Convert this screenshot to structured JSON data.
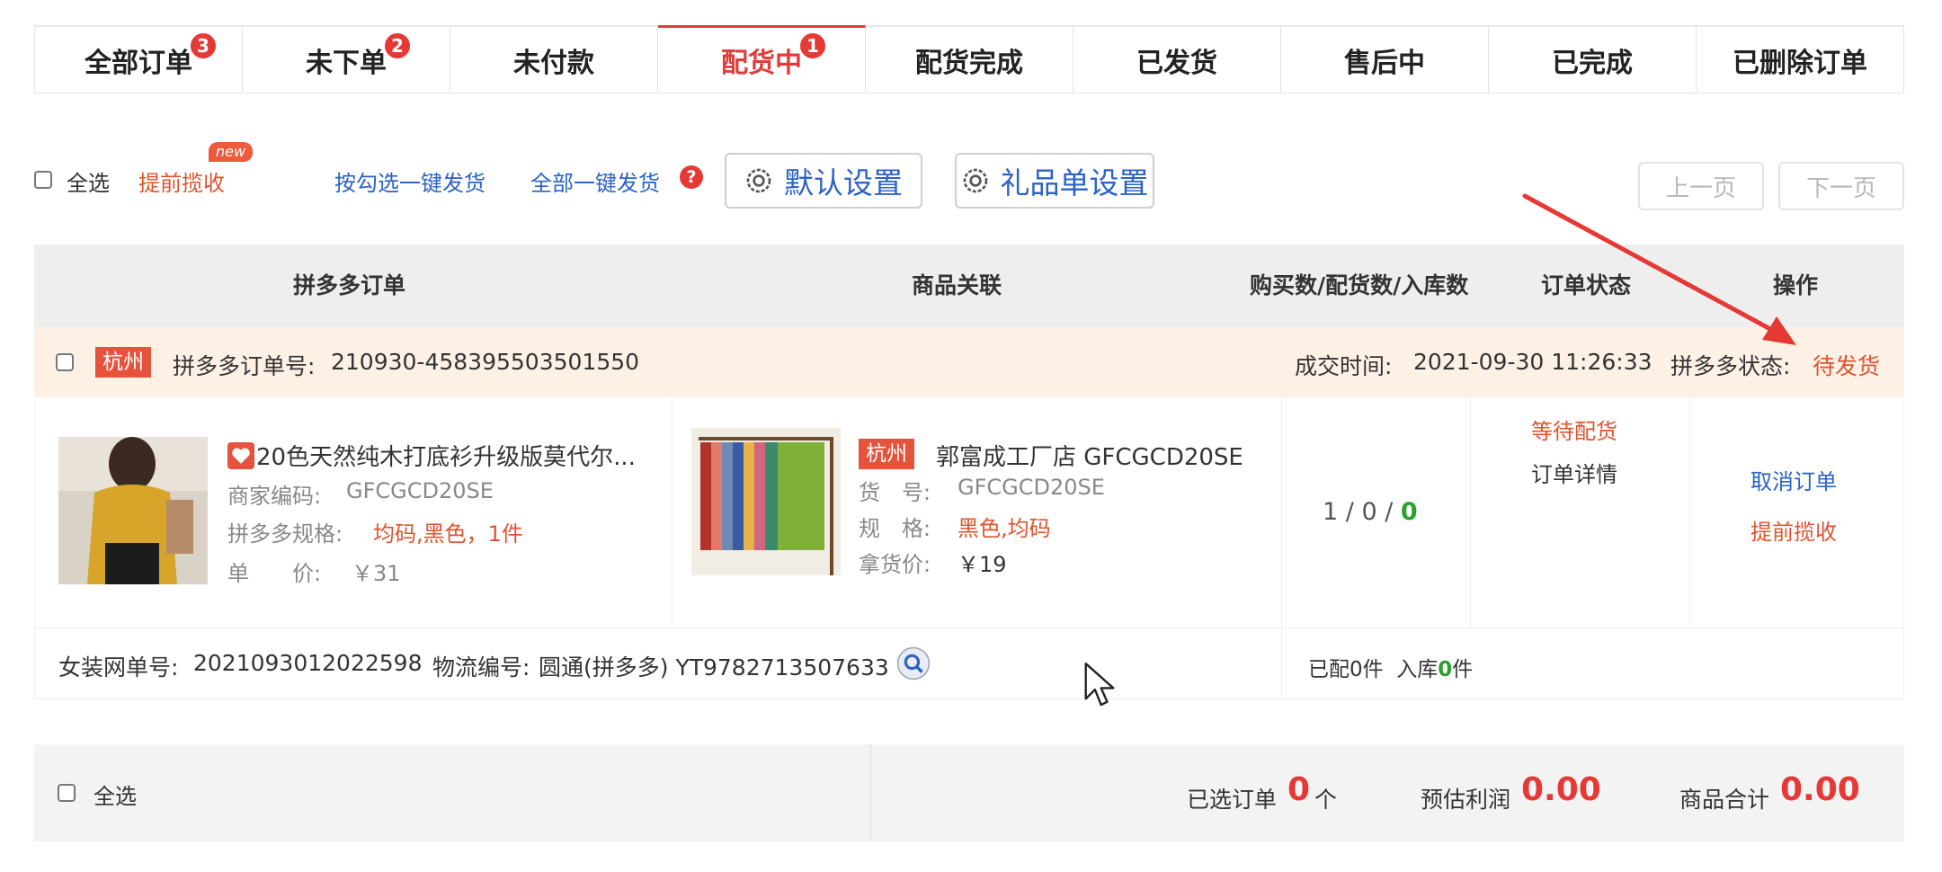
{
  "tabs": [
    {
      "label": "全部订单",
      "badge": "3"
    },
    {
      "label": "未下单",
      "badge": "2"
    },
    {
      "label": "未付款",
      "badge": ""
    },
    {
      "label": "配货中",
      "badge": "1"
    },
    {
      "label": "配货完成",
      "badge": ""
    },
    {
      "label": "已发货",
      "badge": ""
    },
    {
      "label": "售后中",
      "badge": ""
    },
    {
      "label": "已完成",
      "badge": ""
    },
    {
      "label": "已删除订单",
      "badge": ""
    }
  ],
  "toolbar": {
    "select_all": "全选",
    "early_pickup": "提前揽收",
    "new_badge": "new",
    "ship_checked": "按勾选一键发货",
    "ship_all": "全部一键发货",
    "help_mark": "?",
    "default_settings": "默认设置",
    "gift_settings": "礼品单设置",
    "prev_page": "上一页",
    "next_page": "下一页"
  },
  "table_headers": {
    "order": "拼多多订单",
    "product": "商品关联",
    "counts": "购买数/配货数/入库数",
    "status": "订单状态",
    "action": "操作"
  },
  "order": {
    "city": "杭州",
    "order_no_label": "拼多多订单号:",
    "order_no": "210930-458395503501550",
    "deal_time_label": "成交时间:",
    "deal_time": "2021-09-30 11:26:33",
    "pdd_status_label": "拼多多状态:",
    "pdd_status": "待发货",
    "item": {
      "title": "20色天然纯木打底衫升级版莫代尔...",
      "merchant_code_label": "商家编码:",
      "merchant_code": "GFCGCD20SE",
      "spec_label": "拼多多规格:",
      "spec": "均码,黑色，1件",
      "price_label": "单　　价:",
      "price": "￥31"
    },
    "supplier": {
      "city": "杭州",
      "name": "郭富成工厂店 GFCGCD20SE",
      "goods_no_label": "货　号:",
      "goods_no": "GFCGCD20SE",
      "spec_label": "规　格:",
      "spec": "黑色,均码",
      "price_label": "拿货价:",
      "price": "￥19"
    },
    "counts": {
      "bought": "1",
      "sep1": " / ",
      "allocated": "0",
      "sep2": " / ",
      "stocked": "0"
    },
    "status_main": "等待配货",
    "status_detail": "订单详情",
    "action_cancel": "取消订单",
    "action_pickup": "提前揽收",
    "foot": {
      "site_no_label": "女装网单号:",
      "site_no": "2021093012022598",
      "logistics_label": "物流编号:",
      "logistics": "圆通(拼多多) YT9782713507633",
      "allocated_prefix": "已配",
      "allocated_num": "0",
      "allocated_suffix": "件",
      "stocked_prefix": "入库",
      "stocked_num": "0",
      "stocked_suffix": "件"
    }
  },
  "bottom": {
    "select_all": "全选",
    "selected_label": "已选订单",
    "selected_count": "0",
    "selected_unit": "个",
    "profit_label": "预估利润",
    "profit": "0.00",
    "total_label": "商品合计",
    "total": "0.00"
  },
  "colors": {
    "accent": "#e03c3c",
    "link": "#2b63c6",
    "status": "#e0532f",
    "green": "#2aa22a"
  }
}
